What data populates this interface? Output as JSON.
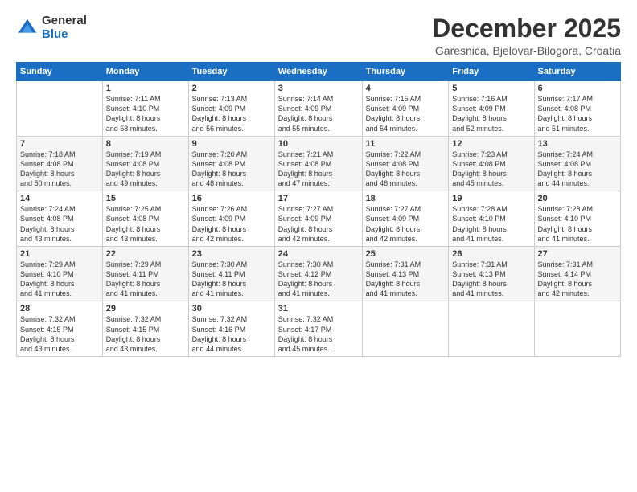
{
  "logo": {
    "general": "General",
    "blue": "Blue"
  },
  "header": {
    "month": "December 2025",
    "location": "Garesnica, Bjelovar-Bilogora, Croatia"
  },
  "weekdays": [
    "Sunday",
    "Monday",
    "Tuesday",
    "Wednesday",
    "Thursday",
    "Friday",
    "Saturday"
  ],
  "weeks": [
    [
      {
        "day": "",
        "info": ""
      },
      {
        "day": "1",
        "info": "Sunrise: 7:11 AM\nSunset: 4:10 PM\nDaylight: 8 hours\nand 58 minutes."
      },
      {
        "day": "2",
        "info": "Sunrise: 7:13 AM\nSunset: 4:09 PM\nDaylight: 8 hours\nand 56 minutes."
      },
      {
        "day": "3",
        "info": "Sunrise: 7:14 AM\nSunset: 4:09 PM\nDaylight: 8 hours\nand 55 minutes."
      },
      {
        "day": "4",
        "info": "Sunrise: 7:15 AM\nSunset: 4:09 PM\nDaylight: 8 hours\nand 54 minutes."
      },
      {
        "day": "5",
        "info": "Sunrise: 7:16 AM\nSunset: 4:09 PM\nDaylight: 8 hours\nand 52 minutes."
      },
      {
        "day": "6",
        "info": "Sunrise: 7:17 AM\nSunset: 4:08 PM\nDaylight: 8 hours\nand 51 minutes."
      }
    ],
    [
      {
        "day": "7",
        "info": "Sunrise: 7:18 AM\nSunset: 4:08 PM\nDaylight: 8 hours\nand 50 minutes."
      },
      {
        "day": "8",
        "info": "Sunrise: 7:19 AM\nSunset: 4:08 PM\nDaylight: 8 hours\nand 49 minutes."
      },
      {
        "day": "9",
        "info": "Sunrise: 7:20 AM\nSunset: 4:08 PM\nDaylight: 8 hours\nand 48 minutes."
      },
      {
        "day": "10",
        "info": "Sunrise: 7:21 AM\nSunset: 4:08 PM\nDaylight: 8 hours\nand 47 minutes."
      },
      {
        "day": "11",
        "info": "Sunrise: 7:22 AM\nSunset: 4:08 PM\nDaylight: 8 hours\nand 46 minutes."
      },
      {
        "day": "12",
        "info": "Sunrise: 7:23 AM\nSunset: 4:08 PM\nDaylight: 8 hours\nand 45 minutes."
      },
      {
        "day": "13",
        "info": "Sunrise: 7:24 AM\nSunset: 4:08 PM\nDaylight: 8 hours\nand 44 minutes."
      }
    ],
    [
      {
        "day": "14",
        "info": "Sunrise: 7:24 AM\nSunset: 4:08 PM\nDaylight: 8 hours\nand 43 minutes."
      },
      {
        "day": "15",
        "info": "Sunrise: 7:25 AM\nSunset: 4:08 PM\nDaylight: 8 hours\nand 43 minutes."
      },
      {
        "day": "16",
        "info": "Sunrise: 7:26 AM\nSunset: 4:09 PM\nDaylight: 8 hours\nand 42 minutes."
      },
      {
        "day": "17",
        "info": "Sunrise: 7:27 AM\nSunset: 4:09 PM\nDaylight: 8 hours\nand 42 minutes."
      },
      {
        "day": "18",
        "info": "Sunrise: 7:27 AM\nSunset: 4:09 PM\nDaylight: 8 hours\nand 42 minutes."
      },
      {
        "day": "19",
        "info": "Sunrise: 7:28 AM\nSunset: 4:10 PM\nDaylight: 8 hours\nand 41 minutes."
      },
      {
        "day": "20",
        "info": "Sunrise: 7:28 AM\nSunset: 4:10 PM\nDaylight: 8 hours\nand 41 minutes."
      }
    ],
    [
      {
        "day": "21",
        "info": "Sunrise: 7:29 AM\nSunset: 4:10 PM\nDaylight: 8 hours\nand 41 minutes."
      },
      {
        "day": "22",
        "info": "Sunrise: 7:29 AM\nSunset: 4:11 PM\nDaylight: 8 hours\nand 41 minutes."
      },
      {
        "day": "23",
        "info": "Sunrise: 7:30 AM\nSunset: 4:11 PM\nDaylight: 8 hours\nand 41 minutes."
      },
      {
        "day": "24",
        "info": "Sunrise: 7:30 AM\nSunset: 4:12 PM\nDaylight: 8 hours\nand 41 minutes."
      },
      {
        "day": "25",
        "info": "Sunrise: 7:31 AM\nSunset: 4:13 PM\nDaylight: 8 hours\nand 41 minutes."
      },
      {
        "day": "26",
        "info": "Sunrise: 7:31 AM\nSunset: 4:13 PM\nDaylight: 8 hours\nand 41 minutes."
      },
      {
        "day": "27",
        "info": "Sunrise: 7:31 AM\nSunset: 4:14 PM\nDaylight: 8 hours\nand 42 minutes."
      }
    ],
    [
      {
        "day": "28",
        "info": "Sunrise: 7:32 AM\nSunset: 4:15 PM\nDaylight: 8 hours\nand 43 minutes."
      },
      {
        "day": "29",
        "info": "Sunrise: 7:32 AM\nSunset: 4:15 PM\nDaylight: 8 hours\nand 43 minutes."
      },
      {
        "day": "30",
        "info": "Sunrise: 7:32 AM\nSunset: 4:16 PM\nDaylight: 8 hours\nand 44 minutes."
      },
      {
        "day": "31",
        "info": "Sunrise: 7:32 AM\nSunset: 4:17 PM\nDaylight: 8 hours\nand 45 minutes."
      },
      {
        "day": "",
        "info": ""
      },
      {
        "day": "",
        "info": ""
      },
      {
        "day": "",
        "info": ""
      }
    ]
  ]
}
